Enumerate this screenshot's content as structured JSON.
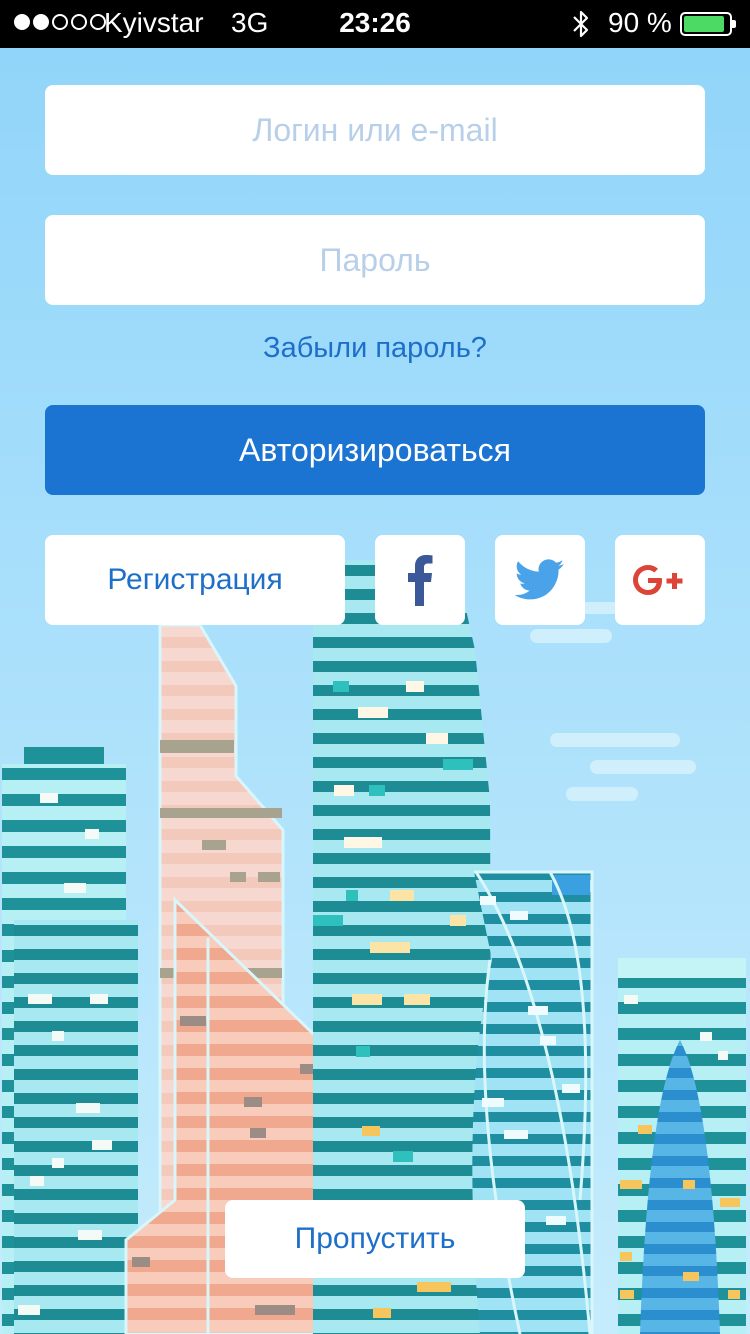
{
  "status_bar": {
    "carrier": "Kyivstar",
    "network": "3G",
    "time": "23:26",
    "battery_percent": "90 %",
    "battery_level": 0.9,
    "signal_bars_filled": 2,
    "signal_bars_total": 5
  },
  "form": {
    "login_placeholder": "Логин или e-mail",
    "password_placeholder": "Пароль",
    "forgot_password": "Забыли пароль?",
    "login_button": "Авторизироваться",
    "register_button": "Регистрация",
    "skip_button": "Пропустить"
  },
  "social": {
    "facebook_icon": "facebook-icon",
    "twitter_icon": "twitter-icon",
    "google_plus_icon": "google-plus-icon"
  },
  "colors": {
    "accent": "#1b73d2",
    "link": "#1d6fc9",
    "background": "#a6defb",
    "facebook": "#3b5998",
    "twitter": "#4aa3e8",
    "google_plus": "#db4437"
  }
}
